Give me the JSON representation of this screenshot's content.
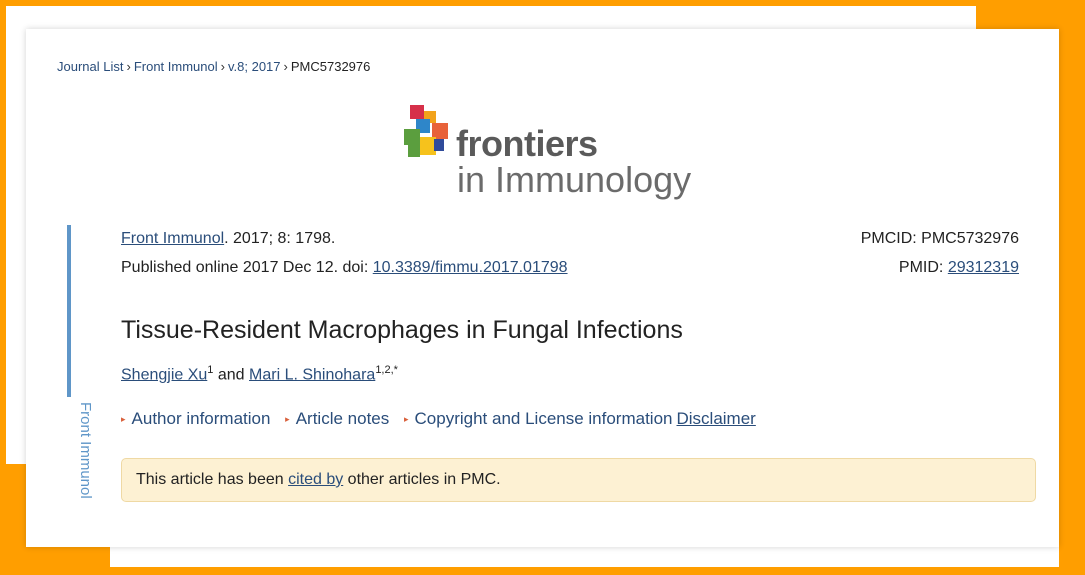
{
  "colors": {
    "frame_orange": "#ff9e00",
    "link_blue": "#2a4d7a",
    "sidebar_blue": "#5f96c8",
    "notice_bg": "#fdf1d3",
    "bullet_red": "#d9603b"
  },
  "breadcrumb": {
    "items": [
      "Journal List",
      "Front Immunol",
      "v.8; 2017"
    ],
    "separator": "›",
    "current": "PMC5732976"
  },
  "logo": {
    "icon": "frontiers-cube-icon",
    "line1": "frontiers",
    "line2": "in Immunology"
  },
  "sidebar": {
    "label": "Front Immunol"
  },
  "citation": {
    "journal_link": "Front Immunol",
    "details": ". 2017; 8: 1798.",
    "published_prefix": "Published online 2017 Dec 12. doi: ",
    "doi": "10.3389/fimmu.2017.01798",
    "pmcid_label": "PMCID: ",
    "pmcid_value": "PMC5732976",
    "pmid_label": "PMID: ",
    "pmid_value": "29312319"
  },
  "article": {
    "title": "Tissue-Resident Macrophages in Fungal Infections",
    "authors": [
      {
        "name": "Shengjie Xu",
        "sup": "1"
      },
      {
        "name": "Mari L. Shinohara",
        "sup": "1,2,*"
      }
    ],
    "author_joiner": " and "
  },
  "links": {
    "bullet": "▸",
    "items": [
      "Author information",
      "Article notes",
      "Copyright and License information"
    ],
    "disclaimer": "Disclaimer"
  },
  "notice": {
    "prefix": "This article has been ",
    "link": "cited by",
    "suffix": " other articles in PMC."
  }
}
